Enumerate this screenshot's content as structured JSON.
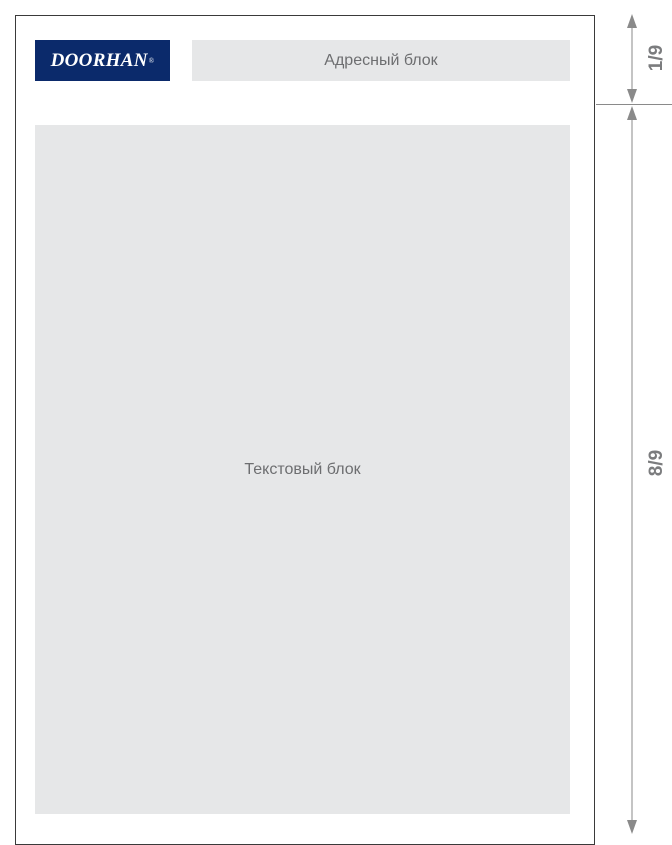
{
  "logo": {
    "text": "DOORHAN",
    "mark": "®"
  },
  "address_block": {
    "label": "Адресный блок"
  },
  "text_block": {
    "label": "Текстовый блок"
  },
  "dimensions": {
    "top_label": "1/9",
    "bottom_label": "8/9"
  },
  "colors": {
    "logo_bg": "#0b2a6b",
    "block_bg": "#e6e7e8",
    "block_text": "#6d6e70",
    "dimension": "#7b7c7e"
  }
}
